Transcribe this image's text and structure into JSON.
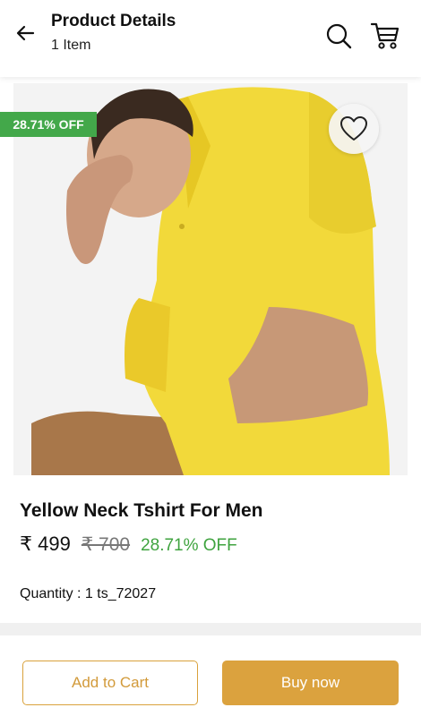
{
  "header": {
    "title": "Product Details",
    "subtitle": "1 Item",
    "back_icon": "arrow-left-icon",
    "search_icon": "search-icon",
    "cart_icon": "cart-icon"
  },
  "product": {
    "discount_badge": "28.71% OFF",
    "wishlist_icon": "heart-outline-icon",
    "name": "Yellow Neck Tshirt For Men",
    "price": "₹ 499",
    "mrp": "₹ 700",
    "discount_text": "28.71% OFF",
    "quantity": "Quantity : 1 ts_72027"
  },
  "actions": {
    "add_to_cart": "Add to Cart",
    "buy_now": "Buy now"
  },
  "colors": {
    "accent": "#dba23e",
    "discount_green": "#43a84a",
    "shirt_yellow": "#f2d93a"
  }
}
